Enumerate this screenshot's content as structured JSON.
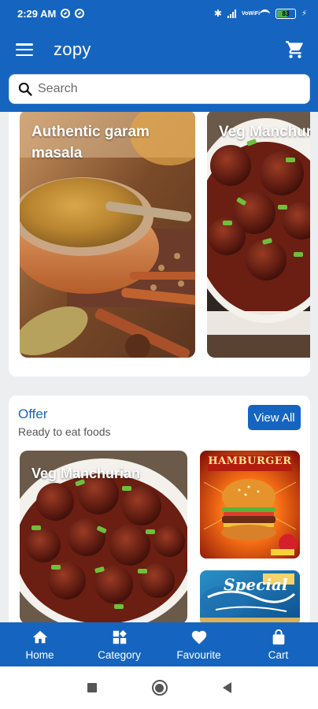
{
  "status_bar": {
    "time": "2:29 AM",
    "network": "VoWiFi",
    "battery": "83"
  },
  "app_bar": {
    "title": "zopy",
    "menu_icon": "menu-icon",
    "cart_icon": "cart-icon"
  },
  "search": {
    "placeholder": "Search",
    "value": ""
  },
  "featured": {
    "items": [
      {
        "title": "Authentic garam masala",
        "image": "garam-masala-image"
      },
      {
        "title": "Veg Manchurian",
        "image": "veg-manchurian-image"
      }
    ]
  },
  "offer": {
    "title": "Offer",
    "subtitle": "Ready to eat foods",
    "view_all_label": "View All",
    "items": [
      {
        "title": "Veg Manchurian",
        "image": "veg-manchurian-image"
      },
      {
        "title": "",
        "image": "hamburger-poster-image"
      },
      {
        "title": "",
        "image": "todays-special-menu-image"
      }
    ]
  },
  "bottom_nav": {
    "items": [
      {
        "label": "Home",
        "icon": "home-icon"
      },
      {
        "label": "Category",
        "icon": "category-icon"
      },
      {
        "label": "Favourite",
        "icon": "heart-icon"
      },
      {
        "label": "Cart",
        "icon": "shopping-bag-icon"
      }
    ]
  },
  "colors": {
    "primary": "#1565c0",
    "background": "#eceef0",
    "card": "#ffffff"
  }
}
